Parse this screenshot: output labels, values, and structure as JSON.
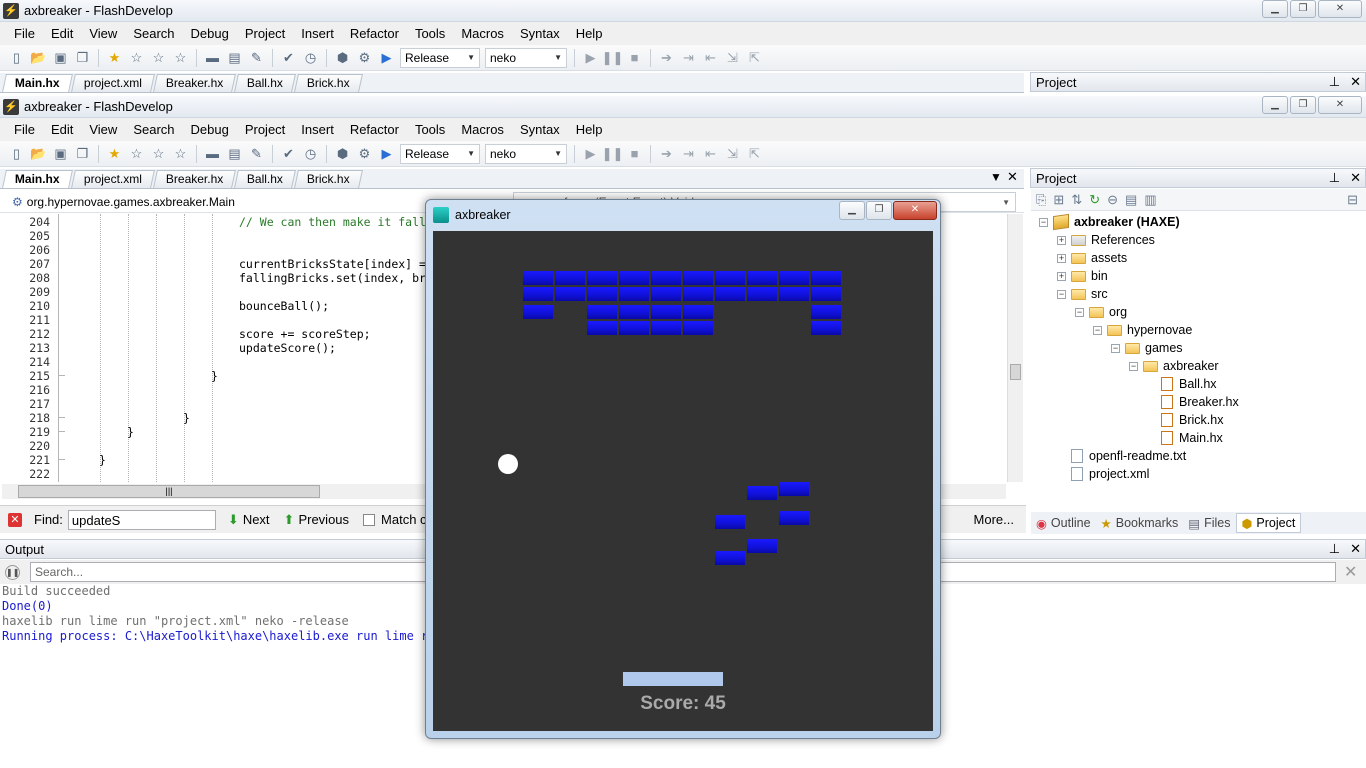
{
  "window": {
    "title": "axbreaker - FlashDevelop"
  },
  "menu": [
    "File",
    "Edit",
    "View",
    "Search",
    "Debug",
    "Project",
    "Insert",
    "Refactor",
    "Tools",
    "Macros",
    "Syntax",
    "Help"
  ],
  "toolbar": {
    "config": "Release",
    "target": "neko"
  },
  "tabs": [
    "Main.hx",
    "project.xml",
    "Breaker.hx",
    "Ball.hx",
    "Brick.hx"
  ],
  "editor": {
    "breadcrumb": "org.hypernovae.games.axbreaker.Main",
    "member": "frame(Event:Event):Void",
    "lines": [
      {
        "n": "204",
        "t": "// We can then make it fall",
        "c": true
      },
      {
        "n": "205",
        "t": ""
      },
      {
        "n": "206",
        "t": ""
      },
      {
        "n": "207",
        "t": "currentBricksState[index] ="
      },
      {
        "n": "208",
        "t": "fallingBricks.set(index, br"
      },
      {
        "n": "209",
        "t": ""
      },
      {
        "n": "210",
        "t": "bounceBall();"
      },
      {
        "n": "211",
        "t": ""
      },
      {
        "n": "212",
        "t": "score += scoreStep;"
      },
      {
        "n": "213",
        "t": "updateScore();"
      },
      {
        "n": "214",
        "t": ""
      },
      {
        "n": "215",
        "t": "}"
      },
      {
        "n": "216",
        "t": ""
      },
      {
        "n": "217",
        "t": ""
      },
      {
        "n": "218",
        "t": "}"
      },
      {
        "n": "219",
        "t": "}"
      },
      {
        "n": "220",
        "t": ""
      },
      {
        "n": "221",
        "t": "}"
      },
      {
        "n": "222",
        "t": ""
      }
    ]
  },
  "find": {
    "label": "Find:",
    "value": "updateS",
    "next": "Next",
    "previous": "Previous",
    "match_case": "Match case",
    "more": "More..."
  },
  "project_panel": {
    "title": "Project",
    "items": [
      {
        "label": "axbreaker (HAXE)",
        "type": "root"
      },
      {
        "label": "References",
        "type": "folder"
      },
      {
        "label": "assets",
        "type": "folder"
      },
      {
        "label": "bin",
        "type": "folder"
      },
      {
        "label": "src",
        "type": "folder"
      },
      {
        "label": "org",
        "type": "folder"
      },
      {
        "label": "hypernovae",
        "type": "folder"
      },
      {
        "label": "games",
        "type": "folder"
      },
      {
        "label": "axbreaker",
        "type": "folder"
      },
      {
        "label": "Ball.hx",
        "type": "file"
      },
      {
        "label": "Breaker.hx",
        "type": "file"
      },
      {
        "label": "Brick.hx",
        "type": "file"
      },
      {
        "label": "Main.hx",
        "type": "file"
      },
      {
        "label": "openfl-readme.txt",
        "type": "file"
      },
      {
        "label": "project.xml",
        "type": "file"
      }
    ],
    "bottom_tabs": [
      "Outline",
      "Bookmarks",
      "Files",
      "Project"
    ]
  },
  "output": {
    "title": "Output",
    "search_placeholder": "Search...",
    "lines": [
      {
        "t": "Build succeeded",
        "color": "#707070"
      },
      {
        "t": "Done(0)",
        "color": "#1a1ad0"
      },
      {
        "t": "haxelib run lime run \"project.xml\" neko -release",
        "color": "#707070"
      },
      {
        "t": "Running process: C:\\HaxeToolkit\\haxe\\haxelib.exe run lime run",
        "color": "#1a1ad0"
      }
    ]
  },
  "game": {
    "title": "axbreaker",
    "score_text": "Score: 45",
    "colors": {
      "background": "#333333",
      "brick": "#1414e6",
      "paddle": "#b0c8ec",
      "ball": "#ffffff"
    }
  }
}
